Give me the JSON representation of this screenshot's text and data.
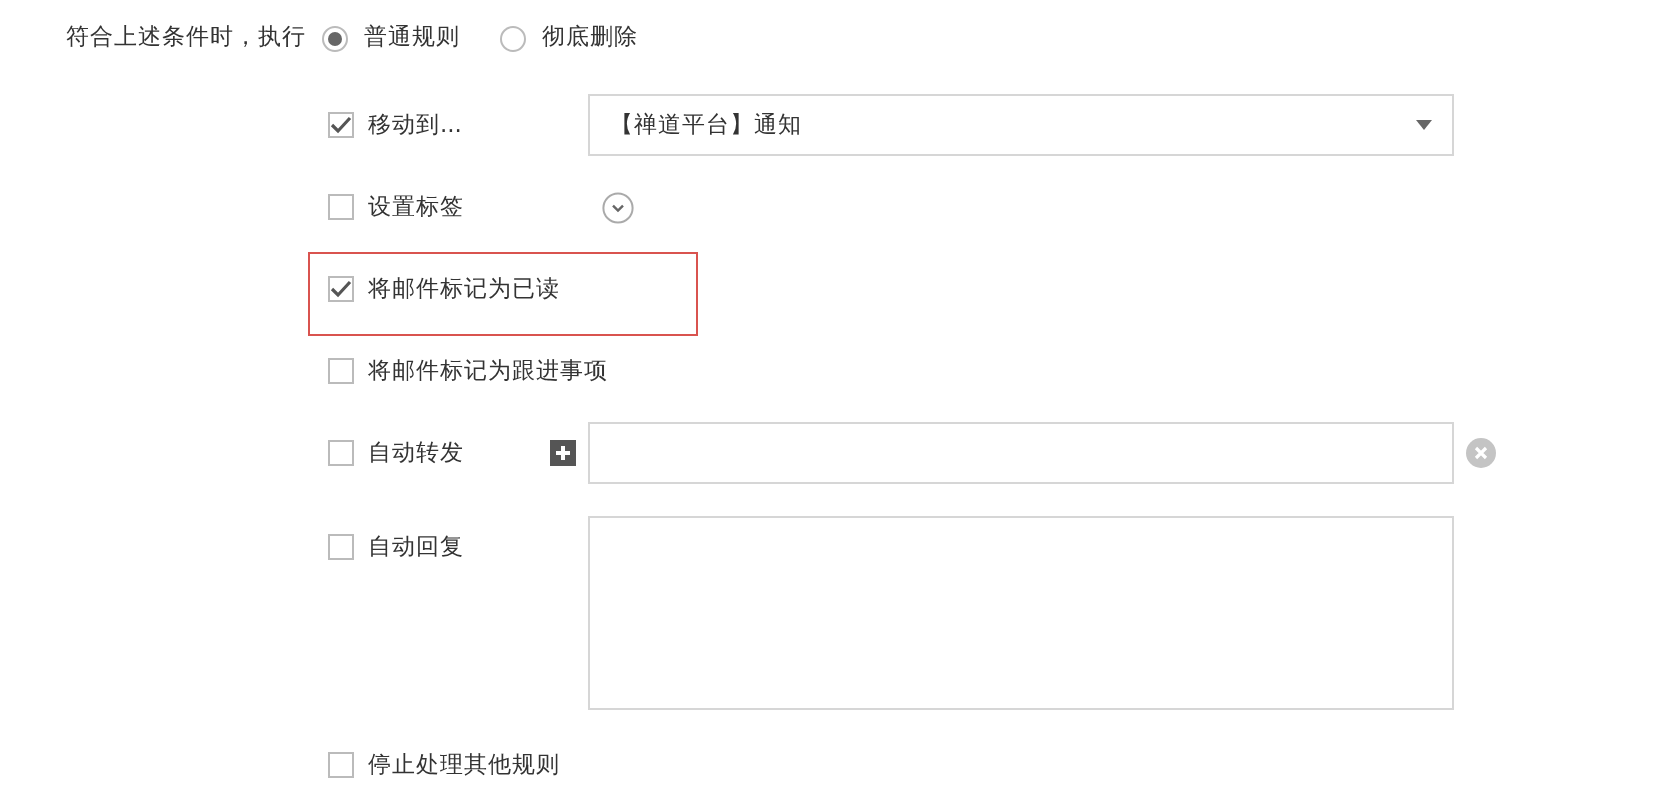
{
  "condition_label": "符合上述条件时，执行",
  "modes": [
    {
      "label": "普通规则",
      "selected": true
    },
    {
      "label": "彻底删除",
      "selected": false
    }
  ],
  "options": [
    {
      "kind": "select",
      "label": "移动到...",
      "checked": true,
      "highlighted": false,
      "value": "【禅道平台】通知"
    },
    {
      "kind": "expand",
      "label": "设置标签",
      "checked": false,
      "highlighted": false
    },
    {
      "kind": "plain",
      "label": "将邮件标记为已读",
      "checked": true,
      "highlighted": true
    },
    {
      "kind": "plain",
      "label": "将邮件标记为跟进事项",
      "checked": false,
      "highlighted": false
    },
    {
      "kind": "forward",
      "label": "自动转发",
      "checked": false,
      "highlighted": false
    },
    {
      "kind": "reply",
      "label": "自动回复",
      "checked": false,
      "highlighted": false
    },
    {
      "kind": "plain",
      "label": "停止处理其他规则",
      "checked": false,
      "highlighted": false
    }
  ]
}
